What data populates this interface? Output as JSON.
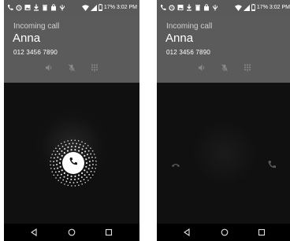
{
  "screens": [
    {
      "id": "left",
      "status_bar": {
        "icons": [
          "call-icon",
          "alarm-icon",
          "image-icon",
          "download-icon",
          "trash-icon",
          "bag-icon",
          "usb-icon",
          "wifi-icon",
          "signal-icon",
          "battery-icon"
        ],
        "battery": "17%",
        "time": "3:02 PM"
      },
      "call": {
        "status": "Incoming call",
        "caller_name": "Anna",
        "caller_number": "012 3456 7890",
        "controls": [
          "speaker-icon",
          "mute-icon",
          "dialpad-icon"
        ]
      },
      "answer": {
        "state": "ring",
        "center_icon": "phone-icon"
      },
      "nav": [
        "back-icon",
        "home-icon",
        "recents-icon"
      ]
    },
    {
      "id": "right",
      "status_bar": {
        "icons": [
          "call-icon",
          "alarm-icon",
          "image-icon",
          "download-icon",
          "trash-icon",
          "bag-icon",
          "usb-icon",
          "wifi-icon",
          "signal-icon",
          "battery-icon"
        ],
        "battery": "17%",
        "time": "3:02 PM"
      },
      "call": {
        "status": "Incoming call",
        "caller_name": "Anna",
        "caller_number": "012 3456 7890",
        "controls": [
          "speaker-icon",
          "mute-icon",
          "dialpad-icon"
        ]
      },
      "answer": {
        "state": "dragging",
        "left_icon": "decline-icon",
        "right_icon": "accept-icon"
      },
      "nav": [
        "back-icon",
        "home-icon",
        "recents-icon"
      ]
    }
  ],
  "colors": {
    "header": "#5b5b5b",
    "status_bar": "#5a5a5a",
    "background": "#101010",
    "answer_button": "#ffffff"
  }
}
